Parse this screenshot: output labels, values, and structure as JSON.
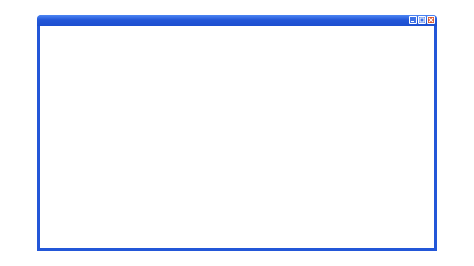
{
  "window": {
    "title": "",
    "frame_color": "#2357d8",
    "close_color": "#d9552d",
    "controls": {
      "minimize": "minimize-icon",
      "maximize": "maximize-icon",
      "close": "close-icon"
    }
  }
}
